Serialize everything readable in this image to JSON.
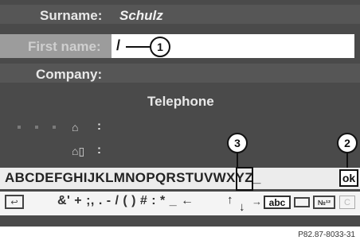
{
  "form": {
    "surname_label": "Surname:",
    "surname_value": "Schulz",
    "first_name_label": "First name:",
    "first_name_value": "/",
    "company_label": "Company:",
    "telephone_header": "Telephone",
    "phone_colon_1": ":",
    "phone_colon_2": ":"
  },
  "keyboard": {
    "characters": "ABCDEFGHIJKLMNOPQRSTUVWXYZ_",
    "ok_label": "ok",
    "symbols": "&' + ;, . - / ( ) # : * _ ←",
    "shift_up": "↑",
    "shift_down": "↓",
    "abc_label": "abc",
    "mode_label": "№¹²",
    "clear_label": "C",
    "back_label": "↩"
  },
  "callouts": [
    "1",
    "2",
    "3"
  ],
  "reference_code": "P82.87-8033-31",
  "icons": {
    "home": "home-icon",
    "home_phone": "home-phone-icon",
    "back": "back-icon",
    "space": "space-icon"
  }
}
